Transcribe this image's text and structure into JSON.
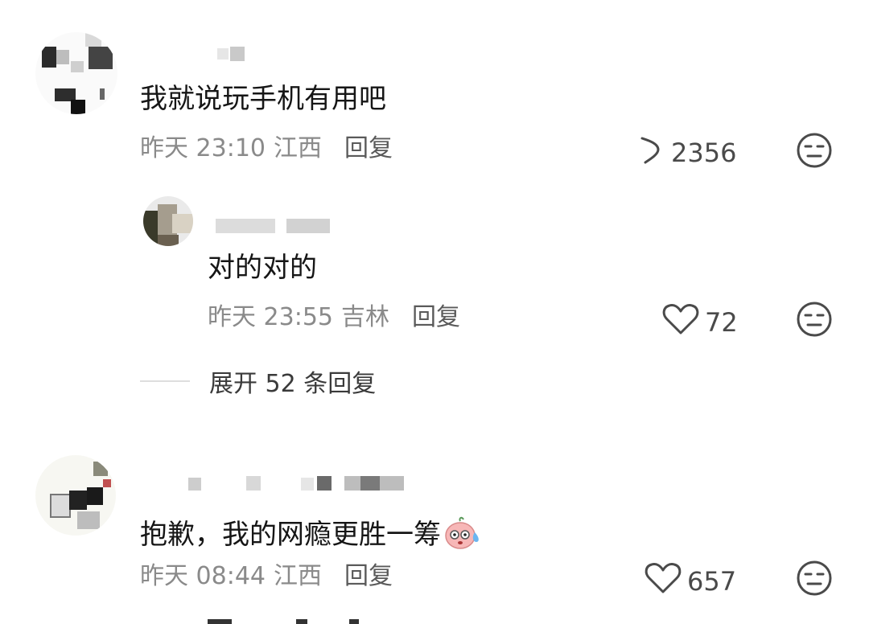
{
  "comments": [
    {
      "text": "我就说玩手机有用吧",
      "time": "昨天 23:10",
      "location": "江西",
      "reply_label": "回复",
      "likes": "2356",
      "like_icon": "heart-icon-partial"
    },
    {
      "text": "对的对的",
      "time": "昨天 23:55",
      "location": "吉林",
      "reply_label": "回复",
      "likes": "72",
      "like_icon": "heart-icon"
    },
    {
      "text": "抱歉，我的网瘾更胜一筹",
      "emoji": "sweating-blush-emoji",
      "time": "昨天 08:44",
      "location": "江西",
      "reply_label": "回复",
      "likes": "657",
      "like_icon": "heart-icon"
    }
  ],
  "expand_replies": {
    "label": "展开 52 条回复"
  },
  "icons": {
    "reaction": "neutral-face-icon"
  },
  "colors": {
    "text": "#161616",
    "meta": "#8a8a8a",
    "reply": "#5a5a5a",
    "icon": "#4a4a4a"
  }
}
